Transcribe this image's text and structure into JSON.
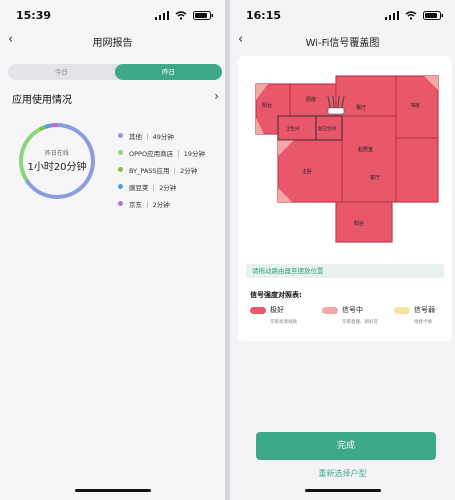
{
  "left": {
    "status": {
      "time": "15:39"
    },
    "nav": {
      "back": "‹",
      "title": "用网报告"
    },
    "tabs": [
      {
        "label": "今日",
        "active": false
      },
      {
        "label": "昨日",
        "active": true
      }
    ],
    "section": {
      "title": "应用使用情况",
      "chevron": "›"
    },
    "donut": {
      "subtitle": "昨日在线",
      "total": "1小时20分钟"
    },
    "usage": [
      {
        "label": "其他 ｜ 49分钟",
        "minutes": 49,
        "color": "#8f9be0"
      },
      {
        "label": "OPPO应用商店 ｜ 19分钟",
        "minutes": 19,
        "color": "#8ad67a"
      },
      {
        "label": "BY_PASS应用 ｜ 2分钟",
        "minutes": 2,
        "color": "#86c33a"
      },
      {
        "label": "豌豆荚 ｜ 2分钟",
        "minutes": 2,
        "color": "#4aa3df"
      },
      {
        "label": "京东 ｜ 2分钟",
        "minutes": 2,
        "color": "#c26ad3"
      }
    ]
  },
  "right": {
    "status": {
      "time": "16:15"
    },
    "nav": {
      "back": "‹",
      "title": "Wi-Fi信号覆盖图"
    },
    "rooms": [
      "阳台",
      "厨房",
      "餐厅",
      "书房",
      "卫生间",
      "副卫生间",
      "起居室",
      "主卧",
      "客厅",
      "阳台"
    ],
    "hint": "请拖动路由器至摆放位置",
    "legend": {
      "title": "信号强度对照表:",
      "items": [
        {
          "label": "极好",
          "desc": "可看高清视频",
          "color": "#e8576a"
        },
        {
          "label": "信号中",
          "desc": "可看直播、刷抖音",
          "color": "#f2a9a6"
        },
        {
          "label": "信号弱",
          "desc": "视频卡顿",
          "color": "#f7e3a4"
        }
      ]
    },
    "actions": {
      "done": "完成",
      "reselect": "重新选择户型"
    },
    "colors": {
      "accent": "#3da88a",
      "strong": "#e8576a",
      "medium": "#f2a9a6",
      "weak": "#f7e3a4"
    }
  }
}
